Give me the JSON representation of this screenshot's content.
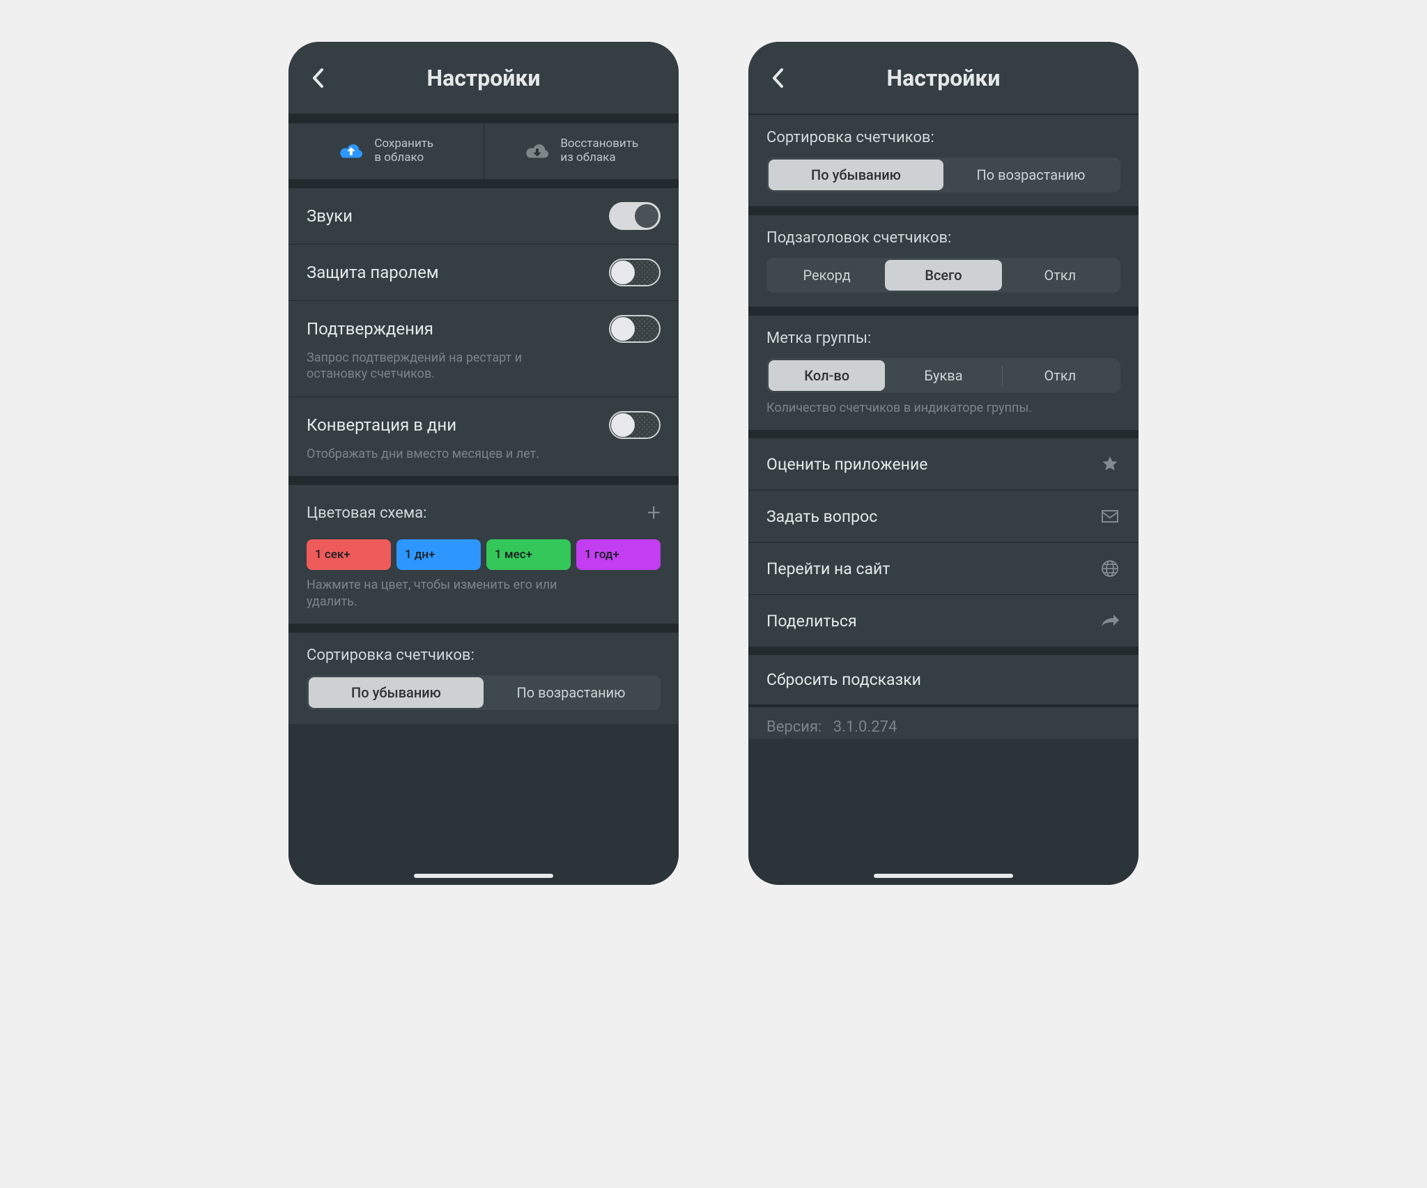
{
  "header": {
    "title": "Настройки"
  },
  "cloud": {
    "save_l1": "Сохранить",
    "save_l2": "в облако",
    "restore_l1": "Восстановить",
    "restore_l2": "из облака"
  },
  "toggles": {
    "sounds": {
      "label": "Звуки",
      "on": true
    },
    "password": {
      "label": "Защита паролем",
      "on": false
    },
    "confirm": {
      "label": "Подтверждения",
      "on": false,
      "sub": "Запрос подтверждений на рестарт и остановку счетчиков."
    },
    "convert": {
      "label": "Конвертация в дни",
      "on": false,
      "sub": "Отображать дни вместо месяцев и лет."
    }
  },
  "colors": {
    "title": "Цветовая схема:",
    "hint": "Нажмите на цвет, чтобы изменить его или удалить.",
    "items": [
      {
        "label": "1 сек+",
        "hex": "#ef5b5b"
      },
      {
        "label": "1 дн+",
        "hex": "#2d97ff"
      },
      {
        "label": "1 мес+",
        "hex": "#34c759"
      },
      {
        "label": "1 год+",
        "hex": "#c23ef0"
      }
    ]
  },
  "sort": {
    "title": "Сортировка счетчиков:",
    "options": [
      "По убыванию",
      "По возрастанию"
    ],
    "selected": 0
  },
  "subtitle": {
    "title": "Подзаголовок счетчиков:",
    "options": [
      "Рекорд",
      "Всего",
      "Откл"
    ],
    "selected": 1
  },
  "grouplabel": {
    "title": "Метка группы:",
    "options": [
      "Кол-во",
      "Буква",
      "Откл"
    ],
    "selected": 0,
    "hint": "Количество счетчиков в индикаторе группы."
  },
  "links": {
    "rate": "Оценить приложение",
    "ask": "Задать вопрос",
    "site": "Перейти на сайт",
    "share": "Поделиться",
    "reset": "Сбросить подсказки"
  },
  "version": {
    "label": "Версия:",
    "value": "3.1.0.274"
  }
}
